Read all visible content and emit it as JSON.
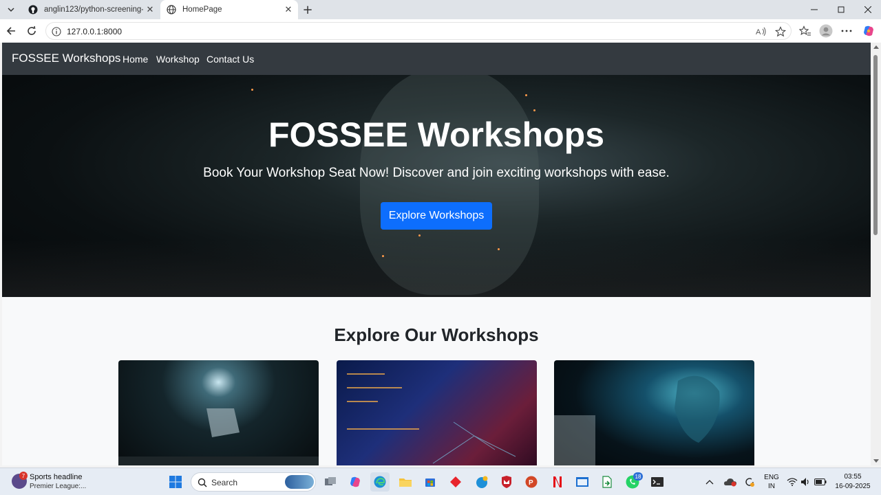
{
  "browser": {
    "tabs": [
      {
        "label": "anglin123/python-screening-task",
        "favicon": "github-icon"
      },
      {
        "label": "HomePage",
        "favicon": "globe-icon",
        "active": true
      }
    ],
    "url": "127.0.0.1:8000"
  },
  "site": {
    "brand": "FOSSEE Workshops",
    "nav": [
      "Home",
      "Workshop",
      "Contact Us"
    ],
    "hero": {
      "title": "FOSSEE Workshops",
      "subtitle": "Book Your Workshop Seat Now! Discover and join exciting workshops with ease.",
      "cta": "Explore Workshops"
    },
    "section_title": "Explore Our Workshops",
    "colors": {
      "navbar": "#343a40",
      "primary": "#0d6efd",
      "page_bg": "#f8f9fa"
    }
  },
  "taskbar": {
    "news": {
      "badge": "7",
      "title": "Sports headline",
      "subtitle": "Premier League:..."
    },
    "search_label": "Search",
    "whatsapp_badge": "18",
    "lang": {
      "line1": "ENG",
      "line2": "IN"
    },
    "clock": {
      "time": "03:55",
      "date": "16-09-2025"
    }
  }
}
